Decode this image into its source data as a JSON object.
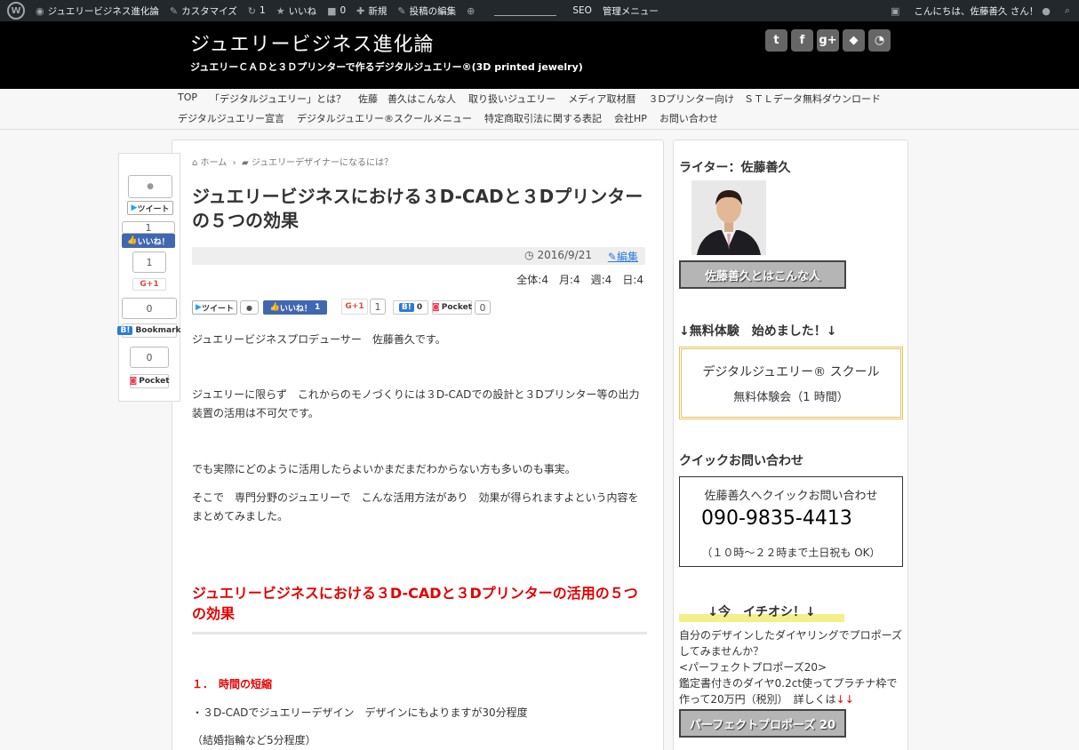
{
  "admin_bar": {
    "site_name": "ジュエリービジネス進化論",
    "customize": "カスタマイズ",
    "updates": "1",
    "likes": "いいね",
    "comments": "0",
    "new": "新規",
    "edit_post": "投稿の編集",
    "seo": "SEO",
    "admin_menu": "管理メニュー",
    "greeting": "こんにちは、佐藤善久 さん！"
  },
  "header": {
    "title": "ジュエリービジネス進化論",
    "description": "ジュエリーＣＡＤと３Ｄプリンターで作るデジタルジュエリー®(3D printed jewelry)",
    "social_icons": [
      "twitter-icon",
      "facebook-icon",
      "google-plus-icon",
      "feedly-icon",
      "rss-icon"
    ]
  },
  "nav": {
    "row1": [
      "TOP",
      "「デジタルジュエリー」とは？",
      "佐藤　善久はこんな人",
      "取り扱いジュエリー",
      "メディア取材暦",
      "３Dプリンター向け　ＳＴＬデータ無料ダウンロード"
    ],
    "row2": [
      "デジタルジュエリー宣言",
      "デジタルジュエリー®スクールメニュー",
      "特定商取引法に関する表記",
      "会社HP",
      "お問い合わせ"
    ]
  },
  "share_column": {
    "tweet": "ツイート",
    "fb_count": "1",
    "fb_like": "いいね！",
    "gplus_count": "1",
    "gplus": "G+1",
    "hatena_count": "0",
    "hatena": "Bookmark",
    "hatena_tag": "B!",
    "pocket_count": "0",
    "pocket": "Pocket"
  },
  "article": {
    "breadcrumb_home": "ホーム",
    "breadcrumb_category": "ジュエリーデザイナーになるには？",
    "title": "ジュエリービジネスにおける３D-CADと３Dプリンターの５つの効果",
    "date": "2016/9/21",
    "edit": "編集",
    "counts": "全体:4　月:4　週:4　日:4",
    "share_row": {
      "tweet": "ツイート",
      "fb_like": "いいね！",
      "fb_count": "1",
      "gplus": "G+1",
      "gplus_count": "1",
      "hatena_tag": "B!",
      "hatena_count": "0",
      "pocket": "Pocket",
      "pocket_count": "0"
    },
    "p1": "ジュエリービジネスプロデューサー　佐藤善久です。",
    "p2": "ジュエリーに限らず　これからのモノづくりには３D-CADでの設計と３Dプリンター等の出力装置の活用は不可欠です。",
    "p3": "でも実際にどのように活用したらよいかまだまだわからない方も多いのも事実。",
    "p4": "そこで　専門分野のジュエリーで　こんな活用方法があり　効果が得られますよという内容をまとめてみました。",
    "h2": "ジュエリービジネスにおける３D-CADと３Dプリンターの活用の５つの効果",
    "h3": "１．　時間の短縮",
    "p5": "・３D-CADでジュエリーデザイン　デザインにもよりますが30分程度",
    "p6": "（結婚指輪など5分程度）"
  },
  "sidebar": {
    "writer_title": "ライター：佐藤善久",
    "writer_button": "佐藤善久とはこんな人",
    "trial_title": "↓無料体験　始めました！↓",
    "trial_line1": "デジタルジュエリー® スクール",
    "trial_line2": "無料体験会（1 時間）",
    "quick_title": "クイックお問い合わせ",
    "quick_line1": "佐藤善久へクイックお問い合わせ",
    "quick_phone": "090-9835-4413",
    "quick_hours": "（１０時～２２時まで土日祝も OK）",
    "rec_title": "↓今　イチオシ！↓",
    "rec_line1": "自分のデザインしたダイヤリングでプロポーズしてみませんか？",
    "rec_line2": "<パーフェクトプロポーズ20>",
    "rec_line3": "鑑定書付きのダイヤ0.2ct使ってプラチナ枠で作って20万円（税別）　詳しくは",
    "rec_arrows": "↓↓",
    "rec_button": "パーフェクトプロポーズ 20"
  }
}
